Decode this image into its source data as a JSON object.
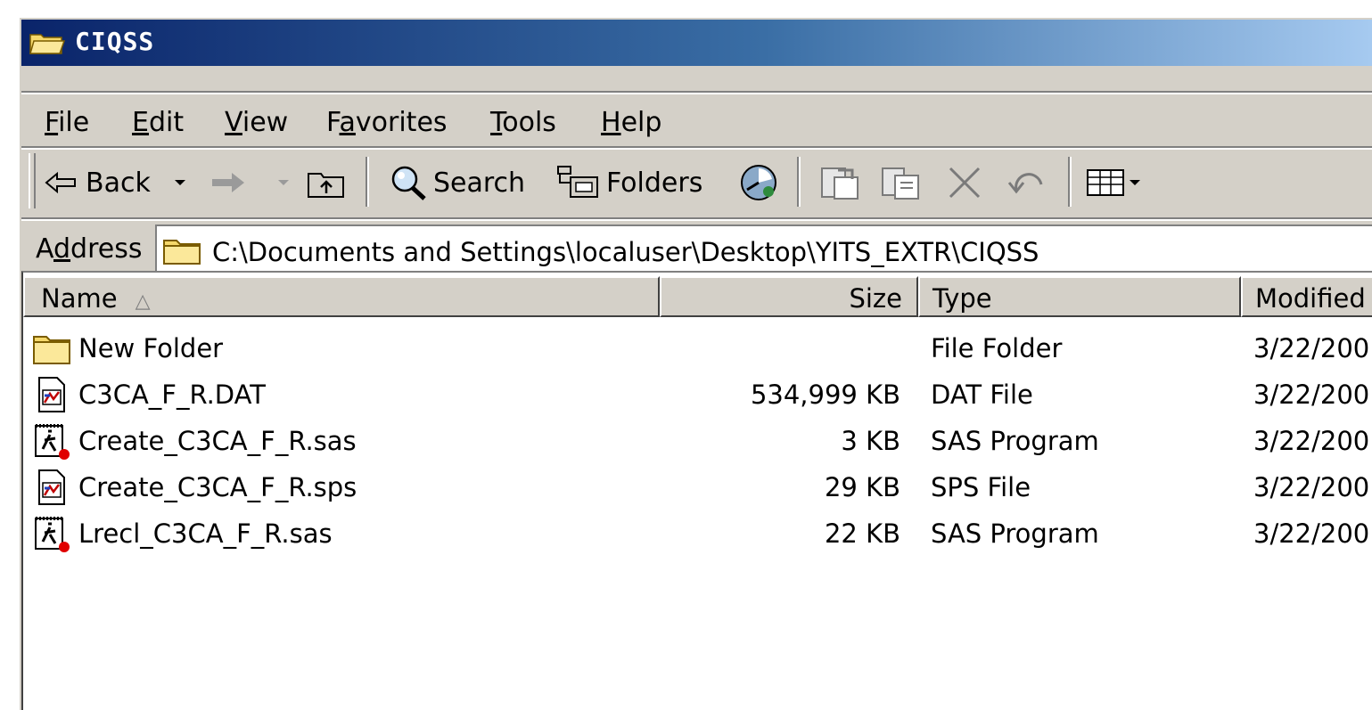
{
  "window": {
    "title": "CIQSS"
  },
  "menu": {
    "items": [
      "File",
      "Edit",
      "View",
      "Favorites",
      "Tools",
      "Help"
    ],
    "mnemonics": [
      "F",
      "E",
      "V",
      "a",
      "T",
      "H"
    ]
  },
  "toolbar": {
    "back_label": "Back",
    "search_label": "Search",
    "folders_label": "Folders"
  },
  "address": {
    "label": "Address",
    "mnemonic": "d",
    "path": "C:\\Documents and Settings\\localuser\\Desktop\\YITS_EXTR\\CIQSS"
  },
  "columns": {
    "name": "Name",
    "size": "Size",
    "type": "Type",
    "modified": "Modified"
  },
  "files": [
    {
      "name": "New Folder",
      "size": "",
      "type": "File Folder",
      "modified": "3/22/200",
      "icon": "folder-icon"
    },
    {
      "name": "C3CA_F_R.DAT",
      "size": "534,999 KB",
      "type": "DAT File",
      "modified": "3/22/200",
      "icon": "data-file-icon"
    },
    {
      "name": "Create_C3CA_F_R.sas",
      "size": "3 KB",
      "type": "SAS Program",
      "modified": "3/22/200",
      "icon": "sas-file-icon"
    },
    {
      "name": "Create_C3CA_F_R.sps",
      "size": "29 KB",
      "type": "SPS File",
      "modified": "3/22/200",
      "icon": "data-file-icon"
    },
    {
      "name": "Lrecl_C3CA_F_R.sas",
      "size": "22 KB",
      "type": "SAS Program",
      "modified": "3/22/200",
      "icon": "sas-file-icon"
    }
  ],
  "colors": {
    "title_start": "#0a246a",
    "title_end": "#a6caf0",
    "chrome": "#d4d0c8",
    "folder_yellow": "#f5d86b"
  }
}
